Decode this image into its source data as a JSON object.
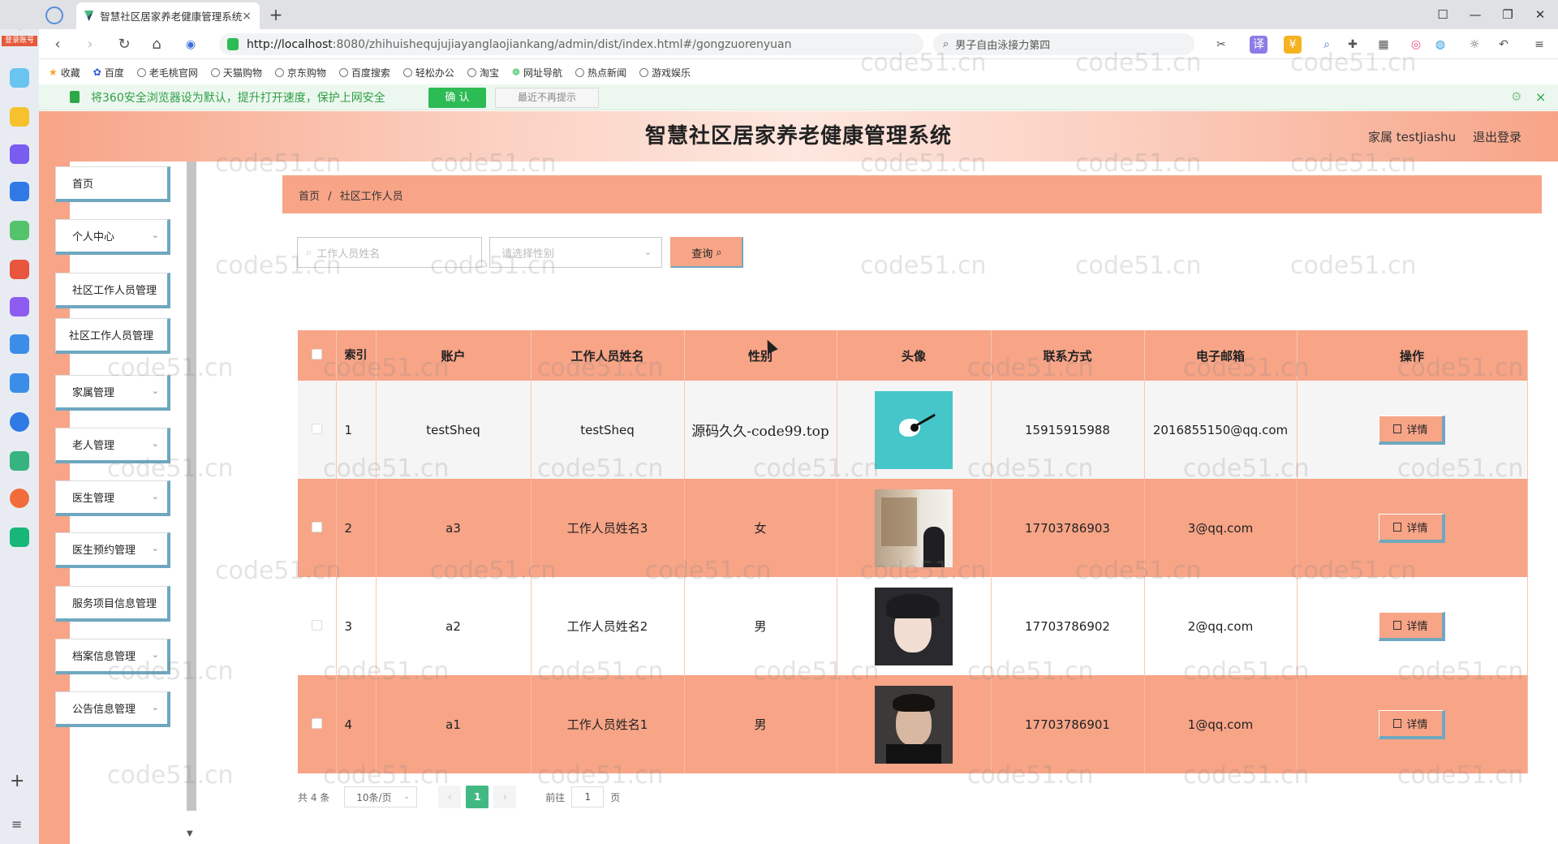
{
  "browser": {
    "tab_title": "智慧社区居家养老健康管理系统",
    "tab_close": "×",
    "new_tab": "+",
    "url_host": "http://localhost",
    "url_rest": ":8080/zhihuishequjujiayanglaojiankang/admin/dist/index.html#/gongzuorenyuan",
    "right_search_text": "男子自由泳接力第四",
    "bookmarks": [
      "收藏",
      "百度",
      "老毛桃官网",
      "天猫购物",
      "京东购物",
      "百度搜索",
      "轻松办公",
      "淘宝",
      "网址导航",
      "热点新闻",
      "游戏娱乐"
    ],
    "security_notice": "将360安全浏览器设为默认，提升打开速度，保护上网安全",
    "security_confirm": "确 认",
    "security_no_remind": "最近不再提示",
    "security_close": "×",
    "security_settings": "⚙",
    "win_controls": [
      "☐",
      "—",
      "❐",
      "✕"
    ],
    "left_badge": "登录账号"
  },
  "app": {
    "title": "智慧社区居家养老健康管理系统",
    "user": "家属 testJiashu",
    "logout": "退出登录",
    "accent_color": "#f7a487",
    "border_color": "#6fa7bf"
  },
  "sidebar": {
    "items": [
      {
        "label": "首页",
        "has_chevron": false
      },
      {
        "label": "个人中心",
        "has_chevron": true
      },
      {
        "label": "社区工作人员管理",
        "has_chevron": false
      },
      {
        "label": "社区工作人员管理",
        "has_chevron": false
      },
      {
        "label": "家属管理",
        "has_chevron": true
      },
      {
        "label": "老人管理",
        "has_chevron": true
      },
      {
        "label": "医生管理",
        "has_chevron": true
      },
      {
        "label": "医生预约管理",
        "has_chevron": true
      },
      {
        "label": "服务项目信息管理",
        "has_chevron": false
      },
      {
        "label": "档案信息管理",
        "has_chevron": true
      },
      {
        "label": "公告信息管理",
        "has_chevron": true
      }
    ]
  },
  "breadcrumb": {
    "home": "首页",
    "separator": "/",
    "current": "社区工作人员"
  },
  "search": {
    "name_placeholder": "工作人员姓名",
    "gender_placeholder": "请选择性别",
    "query_label": "查询"
  },
  "table": {
    "headers": [
      "索引",
      "账户",
      "工作人员姓名",
      "性别",
      "头像",
      "联系方式",
      "电子邮箱",
      "操作"
    ],
    "rows": [
      {
        "index": "1",
        "account": "testSheq",
        "name": "testSheq",
        "gender": "源码久久-code99.top",
        "phone": "15915915988",
        "email": "2016855150@qq.com",
        "action": "详情"
      },
      {
        "index": "2",
        "account": "a3",
        "name": "工作人员姓名3",
        "gender": "女",
        "phone": "17703786903",
        "email": "3@qq.com",
        "action": "详情"
      },
      {
        "index": "3",
        "account": "a2",
        "name": "工作人员姓名2",
        "gender": "男",
        "phone": "17703786902",
        "email": "2@qq.com",
        "action": "详情"
      },
      {
        "index": "4",
        "account": "a1",
        "name": "工作人员姓名1",
        "gender": "男",
        "phone": "17703786901",
        "email": "1@qq.com",
        "action": "详情"
      }
    ]
  },
  "pagination": {
    "total": "共 4 条",
    "page_size": "10条/页",
    "prev": "‹",
    "current": "1",
    "next": "›",
    "goto_prefix": "前往",
    "goto_value": "1",
    "goto_suffix": "页"
  },
  "watermark": "code51.cn"
}
